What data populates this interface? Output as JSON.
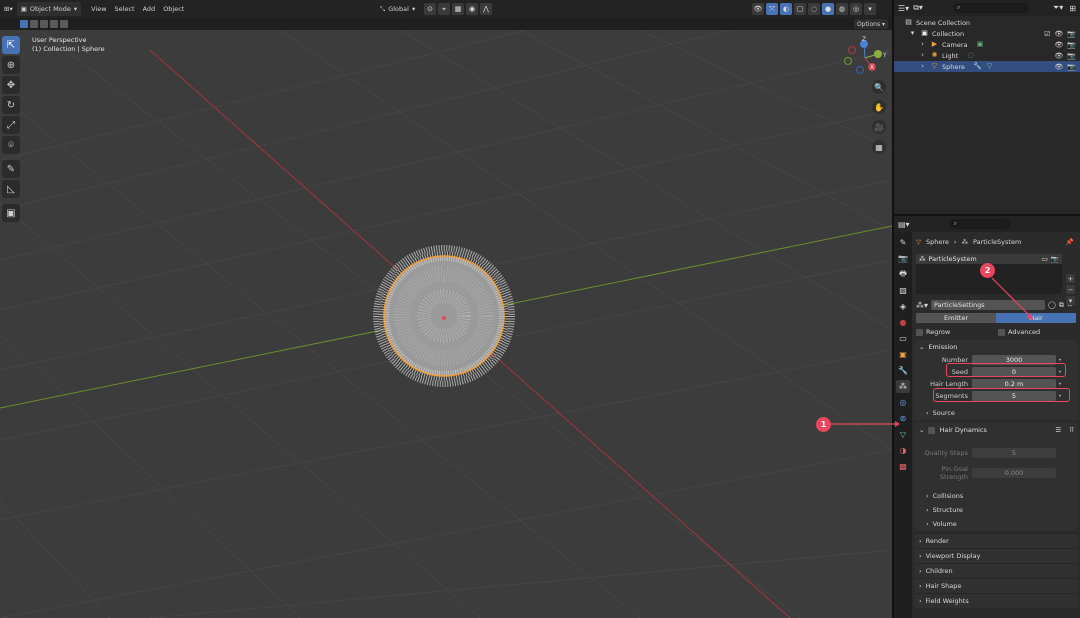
{
  "header": {
    "mode": "Object Mode",
    "menus": [
      "View",
      "Select",
      "Add",
      "Object"
    ],
    "transform_orientation": "Global",
    "options_label": "Options"
  },
  "viewport": {
    "view_name": "User Perspective",
    "collection_info": "(1) Collection | Sphere",
    "gizmo_axes": [
      "X",
      "Y",
      "Z"
    ]
  },
  "outliner": {
    "search_placeholder": "",
    "scene_collection": "Scene Collection",
    "collection": "Collection",
    "items": [
      {
        "label": "Camera",
        "icon": "camera-icon",
        "selected": false
      },
      {
        "label": "Light",
        "icon": "light-icon",
        "selected": false
      },
      {
        "label": "Sphere",
        "icon": "mesh-icon",
        "selected": true
      }
    ]
  },
  "properties": {
    "breadcrumb_object": "Sphere",
    "breadcrumb_system": "ParticleSystem",
    "particle_system_item": "ParticleSystem",
    "settings_name": "ParticleSettings",
    "type_tabs": [
      "Emitter",
      "Hair"
    ],
    "active_type": "Hair",
    "regrow_label": "Regrow",
    "advanced_label": "Advanced",
    "emission": {
      "title": "Emission",
      "rows": [
        {
          "label": "Number",
          "value": "3000"
        },
        {
          "label": "Seed",
          "value": "0"
        },
        {
          "label": "Hair Length",
          "value": "0.2 m"
        },
        {
          "label": "Segments",
          "value": "5"
        }
      ],
      "source_label": "Source"
    },
    "hair_dynamics": {
      "title": "Hair Dynamics",
      "rows": [
        {
          "label": "Quality Steps",
          "value": "5"
        },
        {
          "label": "Pin Goal Strength",
          "value": "0.000"
        }
      ],
      "subpanels": [
        "Collisions",
        "Structure",
        "Volume"
      ]
    },
    "closed_panels": [
      "Render",
      "Viewport Display",
      "Children",
      "Hair Shape",
      "Field Weights"
    ]
  },
  "annotations": {
    "badge1": "1",
    "badge2": "2"
  },
  "colors": {
    "accent": "#4772b3",
    "highlight": "#e8475f",
    "x_axis": "#c8424a",
    "y_axis": "#8ab33a",
    "selection_outline": "#f29d38"
  }
}
